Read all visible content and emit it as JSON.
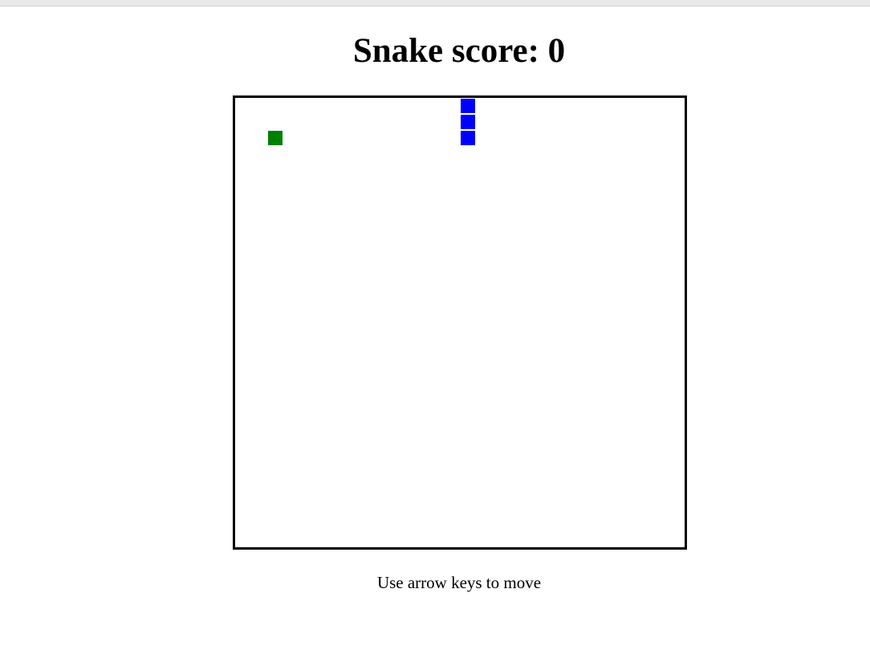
{
  "header": {
    "title": "Snake score: 0"
  },
  "game": {
    "score": 0,
    "grid_columns": 28,
    "grid_rows": 28,
    "snake": [
      {
        "col": 14,
        "row": 0
      },
      {
        "col": 14,
        "row": 1
      },
      {
        "col": 14,
        "row": 2
      }
    ],
    "food": {
      "col": 2,
      "row": 2
    },
    "snake_color": "#0000ff",
    "food_color": "#008000",
    "board_border_color": "#000000"
  },
  "footer": {
    "hint": "Use arrow keys to move"
  }
}
